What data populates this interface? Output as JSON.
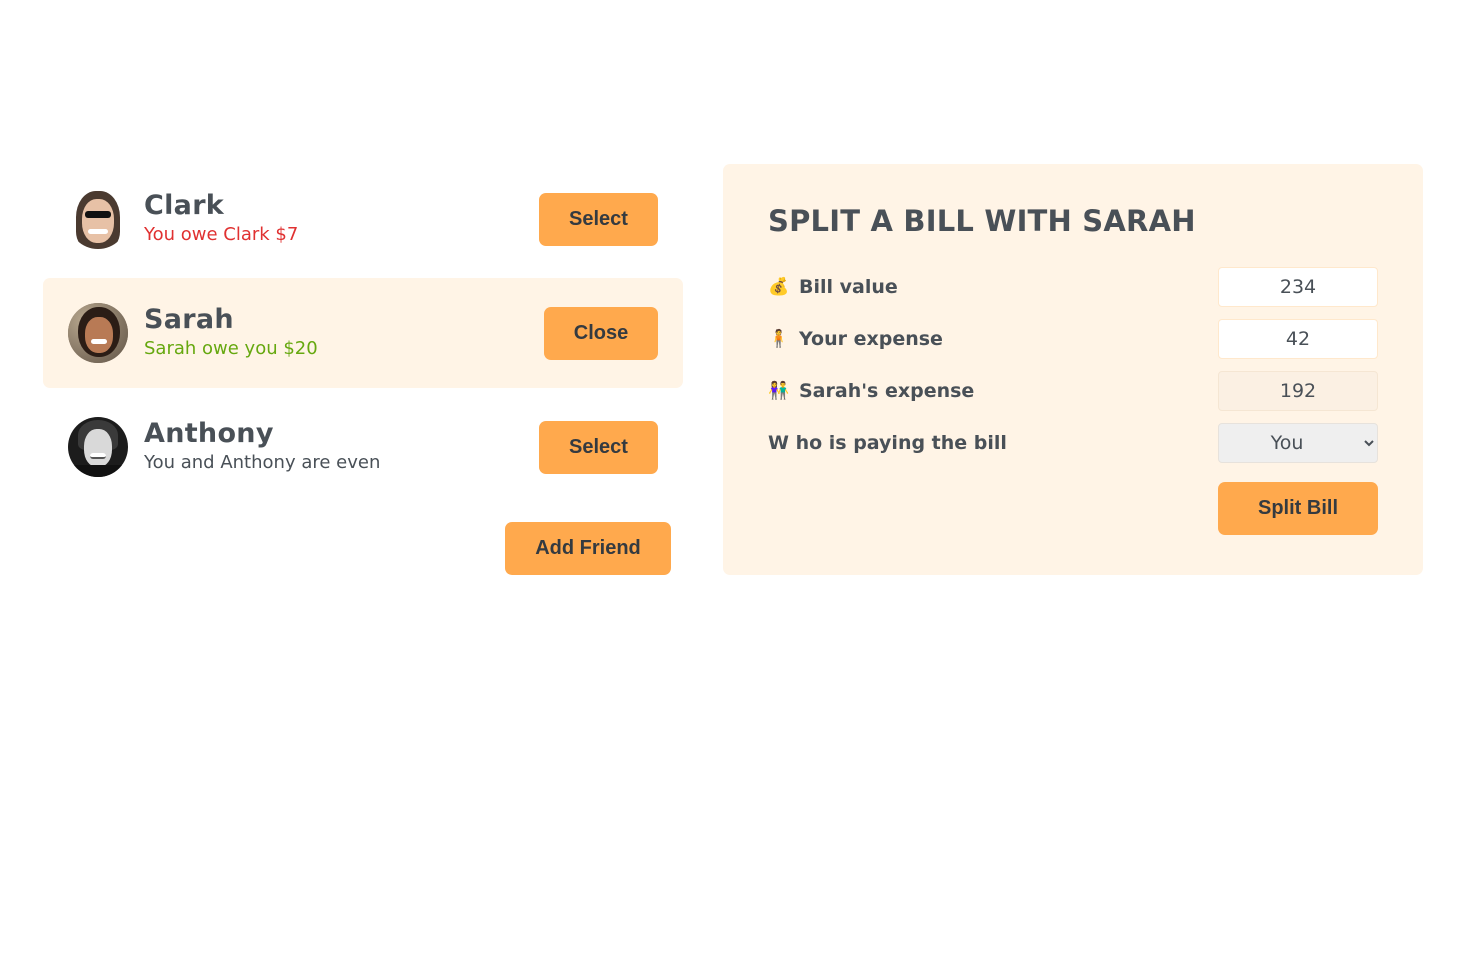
{
  "friends": [
    {
      "name": "Clark",
      "balance_text": "You owe Clark $7",
      "balance_tone": "red",
      "button_label": "Select",
      "selected": false
    },
    {
      "name": "Sarah",
      "balance_text": "Sarah owe you $20",
      "balance_tone": "green",
      "button_label": "Close",
      "selected": true
    },
    {
      "name": "Anthony",
      "balance_text": "You and Anthony are even",
      "balance_tone": "neutral",
      "button_label": "Select",
      "selected": false
    }
  ],
  "add_friend_label": "Add Friend",
  "split": {
    "title": "SPLIT A BILL WITH SARAH",
    "bill_icon": "💰",
    "bill_label": "Bill value",
    "bill_value": "234",
    "your_icon": "🧍",
    "your_label": "Your expense",
    "your_value": "42",
    "friend_icon": "👫",
    "friend_label": "Sarah's expense",
    "friend_value": "192",
    "payer_label": "W ho is paying the bill",
    "payer_selected": "You",
    "submit_label": "Split Bill"
  },
  "colors": {
    "accent": "#ffa94d",
    "panel_bg": "#fff4e6",
    "owe_red": "#e03131",
    "owed_green": "#66a80f",
    "text": "#495057"
  }
}
